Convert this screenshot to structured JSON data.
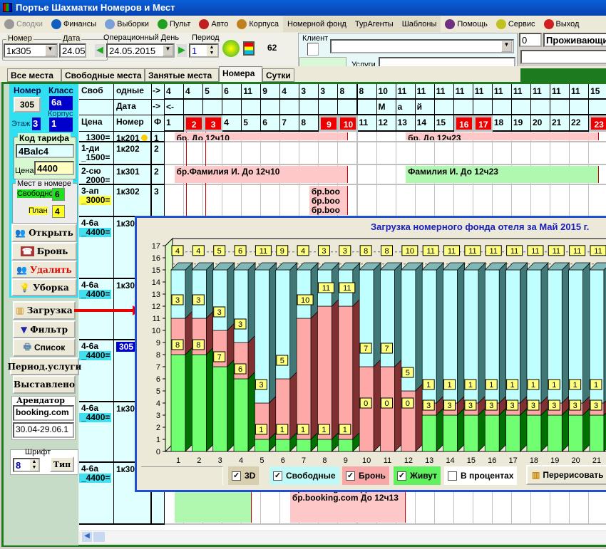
{
  "window": {
    "title": "Портье Шахматки Номеров и Мест"
  },
  "menu": [
    {
      "label": "Сводки",
      "icon": "printer-icon",
      "disabled": true,
      "color": "#999"
    },
    {
      "label": "Финансы",
      "icon": "ruble-icon",
      "color": "#1060c0"
    },
    {
      "label": "Выборки",
      "icon": "list-icon",
      "color": "#7aa0d8"
    },
    {
      "label": "Пульт",
      "icon": "globe-icon",
      "color": "#20a020"
    },
    {
      "label": "Авто",
      "icon": "car-icon",
      "color": "#c02020"
    },
    {
      "label": "Корпуса",
      "icon": "house-icon",
      "color": "#c08020"
    },
    {
      "label": "Номерной фонд",
      "group": true
    },
    {
      "label": "ТурАгенты",
      "group": true
    },
    {
      "label": "Шаблоны",
      "group": true
    },
    {
      "label": "Помощь",
      "icon": "book-icon",
      "color": "#703080"
    },
    {
      "label": "Сервис",
      "icon": "wrench-icon",
      "color": "#c0c020"
    },
    {
      "label": "Выход",
      "icon": "close-icon",
      "color": "#d02020"
    }
  ],
  "toolbar": {
    "room_label": "Номер",
    "room_value": "1к305",
    "date_label": "Дата",
    "date_value": "24.05",
    "opday_label": "Операционный День",
    "opday_value": "24.05.2015",
    "period_label": "Период",
    "period_value": "1",
    "count": "62",
    "client_label": "Клиент",
    "client_value": "",
    "services_label": "Услуги",
    "services_value": "",
    "right_count": "0",
    "right_select": "Проживающие"
  },
  "tabs": [
    {
      "label": "Все места"
    },
    {
      "label": "Свободные места"
    },
    {
      "label": "Занятые места"
    },
    {
      "label": "Номера",
      "active": true
    },
    {
      "label": "Сутки"
    }
  ],
  "left": {
    "room_label": "Номер",
    "room_value": "305",
    "class_label": "Класс",
    "class_value": "6а",
    "building_label": "Корпус",
    "building_value": "1",
    "floor_label": "Этаж",
    "floor_value": "3",
    "tariff_label": "Код тарифа",
    "tariff_value": "4Balc4",
    "price_label": "Цена",
    "price_value": "4400",
    "places_label": "Мест в номере",
    "free_label": "Свободно",
    "free_value": "6",
    "plan_label": "План",
    "plan_value": "4",
    "btn_open": "Открыть",
    "btn_book": "Бронь",
    "btn_delete": "Удалить",
    "btn_clean": "Уборка",
    "btn_load": "Загрузка",
    "btn_filter": "Фильтр",
    "btn_list": "Список",
    "btn_period": "Период.услуги",
    "btn_billed": "Выставлено",
    "tenant_label": "Арендатор",
    "tenant_value": "booking.com",
    "tenant_period": "30.04-29.06.1",
    "font_label": "Шрифт",
    "font_value": "8",
    "btn_type": "Тип"
  },
  "grid": {
    "hdr": {
      "free1": "Своб",
      "free2": "одные",
      "arrow": "->",
      "date": "Дата",
      "arrow2": "->",
      "price": "Цена",
      "number": "Номер",
      "f": "Ф"
    },
    "free_counts": [
      "4",
      "4",
      "5",
      "6",
      "11",
      "9",
      "4",
      "3",
      "3",
      "8",
      "8",
      "10",
      "11",
      "11",
      "11",
      "11",
      "11",
      "11",
      "11",
      "11",
      "11",
      "11",
      "15"
    ],
    "month_row": [
      "<-",
      "",
      "",
      "",
      "",
      "",
      "",
      "",
      "",
      "",
      "",
      "М",
      "а",
      "й",
      "",
      "",
      "",
      "",
      "",
      "",
      "",
      "",
      ""
    ],
    "days": [
      "1",
      "2",
      "3",
      "4",
      "5",
      "6",
      "7",
      "8",
      "9",
      "10",
      "11",
      "12",
      "13",
      "14",
      "15",
      "16",
      "17",
      "18",
      "19",
      "20",
      "21",
      "22",
      "23"
    ],
    "weekends": [
      2,
      3,
      9,
      10,
      16,
      17,
      23
    ],
    "rows": [
      {
        "cls": "",
        "price": "_1300=",
        "number": "1к201",
        "f": "1",
        "mark": true
      },
      {
        "cls": "1-ди",
        "price": "_1500=",
        "number": "1к202",
        "f": "2"
      },
      {
        "cls": "2-сю",
        "price": "_2000=",
        "number": "1к301",
        "f": "2"
      },
      {
        "cls": "3-ап",
        "price": "_3000=",
        "number": "1к302",
        "f": "3",
        "pc": "#ffff40"
      },
      {
        "cls": "4-6а",
        "price": "_4400=",
        "number": "1к30",
        "f": "",
        "pc": "#40e0f0"
      },
      {
        "cls": "4-6а",
        "price": "_4400=",
        "number": "1к30",
        "f": "",
        "pc": "#40e0f0"
      },
      {
        "cls": "4-6а",
        "price": "_4400=",
        "number": "305",
        "f": "",
        "pc": "#40e0f0",
        "selected": true
      },
      {
        "cls": "4-6а",
        "price": "_4400=",
        "number": "1к30",
        "f": "",
        "pc": "#40e0f0"
      },
      {
        "cls": "4-6а",
        "price": "_4400=",
        "number": "1к30",
        "f": "",
        "pc": "#40e0f0"
      }
    ],
    "bookings": [
      {
        "row": 0,
        "from": 1,
        "to": 10,
        "text": "бр. До 12ч10",
        "color": "#ffc8c8"
      },
      {
        "row": 0,
        "from": 13,
        "to": 23,
        "text": "бр. До 12ч23",
        "color": "#ffc8c8"
      },
      {
        "row": 2,
        "from": 1,
        "to": 10,
        "text": "бр.Фамилия И. До 12ч10",
        "color": "#ffc8c8"
      },
      {
        "row": 2,
        "from": 13,
        "to": 23,
        "text": "Фамилия И. До 12ч23",
        "color": "#b0f8b0"
      },
      {
        "row": 3,
        "from": 8,
        "to": 10,
        "text": "бр.boo\nбр.boo\nбр.boo",
        "color": "#ffc8c8"
      },
      {
        "row": 8,
        "from": 1,
        "to": 5,
        "text": "",
        "color": "#b0f8b0"
      },
      {
        "row": 8,
        "from": 7,
        "to": 13,
        "text": "бр.booking.com До 12ч13\nбр.booking.com До 12ч13\nбр.booking.com До 12ч13",
        "color": "#ffc8c8"
      }
    ]
  },
  "chart": {
    "btn_redraw": "Перерисовать",
    "legend": [
      {
        "label": "3D",
        "checked": true,
        "bg": "#d8ceb0"
      },
      {
        "label": "Свободные",
        "checked": true,
        "bg": "#c0f8f8"
      },
      {
        "label": "Бронь",
        "checked": true,
        "bg": "#f8a8a8"
      },
      {
        "label": "Живут",
        "checked": true,
        "bg": "#60f060"
      },
      {
        "label": "В процентах",
        "checked": false,
        "bg": "#ffffff"
      }
    ],
    "colors": {
      "live": "#70ff70",
      "live_side": "#007000",
      "booked": "#ffa8a8",
      "booked_side": "#803030",
      "free": "#c0ffff",
      "free_side": "#407878",
      "free_top": "#80b8b8",
      "label": "#ffff80"
    }
  },
  "chart_data": {
    "type": "bar",
    "title": "Загрузка номерного фонда отеля за  Май 2015 г.",
    "stacked": true,
    "ylim": [
      0,
      17
    ],
    "yticks": [
      "0",
      "1",
      "2",
      "3",
      "4",
      "5",
      "6",
      "7",
      "8",
      "9",
      "10",
      "11",
      "12",
      "13",
      "14",
      "15",
      "16",
      "17"
    ],
    "categories": [
      "1",
      "2",
      "3",
      "4",
      "5",
      "6",
      "7",
      "8",
      "9",
      "10",
      "11",
      "12",
      "13",
      "14",
      "15",
      "16",
      "17",
      "18",
      "19",
      "20",
      "21"
    ],
    "series": [
      {
        "name": "Живут",
        "values": [
          8,
          8,
          7,
          6,
          1,
          1,
          1,
          1,
          1,
          0,
          0,
          0,
          3,
          3,
          3,
          3,
          3,
          3,
          3,
          3,
          3
        ]
      },
      {
        "name": "Бронь",
        "values": [
          3,
          3,
          3,
          3,
          3,
          5,
          10,
          11,
          11,
          7,
          7,
          5,
          1,
          1,
          1,
          1,
          1,
          1,
          1,
          1,
          1
        ]
      },
      {
        "name": "Свободные",
        "values": [
          4,
          4,
          5,
          6,
          11,
          9,
          4,
          3,
          3,
          8,
          8,
          10,
          11,
          11,
          11,
          11,
          11,
          11,
          11,
          11,
          11
        ]
      }
    ],
    "labels": {
      "free": [
        "4",
        "4",
        "5",
        "6",
        "11",
        "9",
        "4",
        "3",
        "3",
        "8",
        "8",
        "10",
        "11",
        "11",
        "11",
        "11",
        "11",
        "11",
        "11",
        "11",
        "11"
      ],
      "booked": [
        "3",
        "3",
        "3",
        "3",
        "3",
        "5",
        "10",
        "11",
        "11",
        "7",
        "7",
        "5",
        "1",
        "1",
        "1",
        "1",
        "1",
        "1",
        "1",
        "1",
        "1"
      ],
      "live": [
        "8",
        "8",
        "7",
        "6",
        "1",
        "1",
        "1",
        "1",
        "1",
        "0",
        "0",
        "0",
        "3",
        "3",
        "3",
        "3",
        "3",
        "3",
        "3",
        "3",
        "3"
      ]
    },
    "legend_position": "bottom"
  }
}
